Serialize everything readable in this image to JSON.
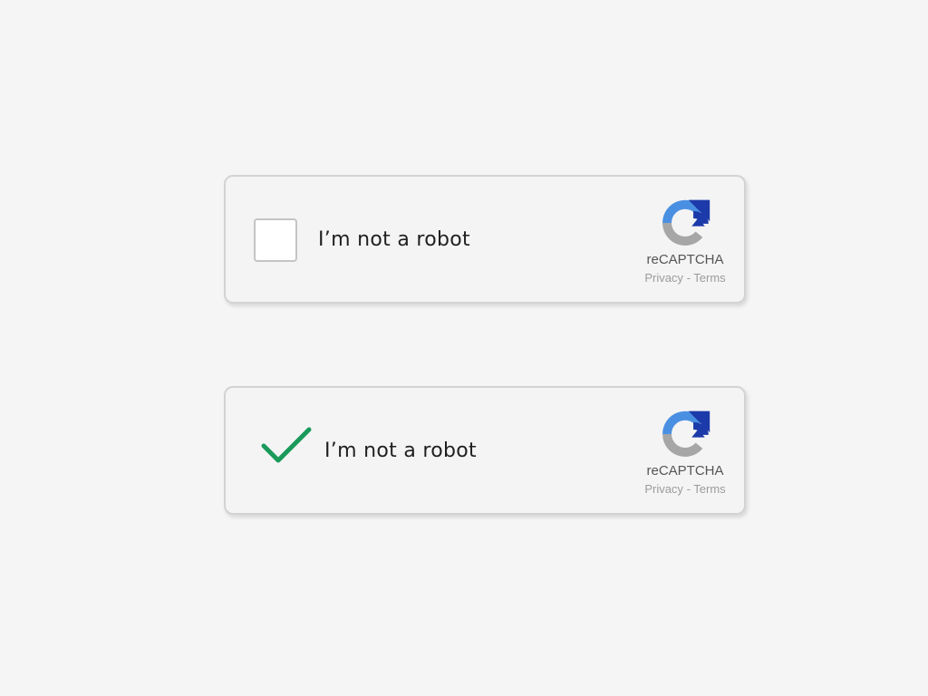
{
  "colors": {
    "page_background": "#f5f5f5",
    "card_border": "#d3d3d3",
    "checkmark": "#1a9a5a",
    "logo_blue_light": "#4a90e2",
    "logo_blue_dark": "#1c3aa9",
    "logo_gray": "#a6a6a6"
  },
  "widgets": [
    {
      "state": "unchecked",
      "checkbox_icon": "empty-checkbox",
      "label": "I’m not a robot",
      "brand": "reCAPTCHA",
      "privacy_link": "Privacy",
      "separator": "-",
      "terms_link": "Terms"
    },
    {
      "state": "checked",
      "checkbox_icon": "green-checkmark",
      "label": "I’m not a robot",
      "brand": "reCAPTCHA",
      "privacy_link": "Privacy",
      "separator": "-",
      "terms_link": "Terms"
    }
  ]
}
